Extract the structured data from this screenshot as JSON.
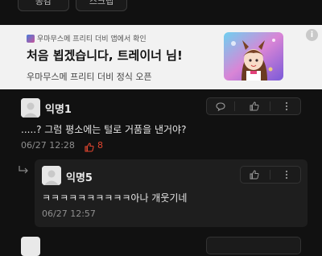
{
  "top_buttons": {
    "left_label": "공감",
    "right_label": "스크랩"
  },
  "ad": {
    "source": "우마무스메 프리티 더비 앱에서 확인",
    "title": "처음 뵙겠습니다, 트레이너 님!",
    "subtitle": "우마무스메 프리티 더비 정식 오픈",
    "info_symbol": "i"
  },
  "comments": [
    {
      "author": "익명1",
      "text": ".....? 그럼 평소에는 털로 거품을 낸거야?",
      "timestamp": "06/27 12:28",
      "like_count": "8",
      "like_color": "#e0452f"
    },
    {
      "author": "익명5",
      "text": "ㅋㅋㅋㅋㅋㅋㅋㅋㅋㅋ아나 개웃기네",
      "timestamp": "06/27 12:57"
    }
  ]
}
